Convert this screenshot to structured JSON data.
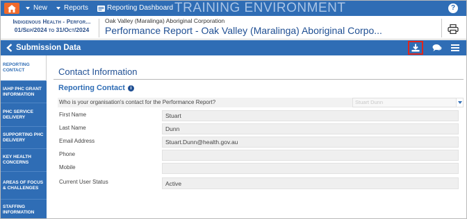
{
  "topnav": {
    "new_label": "New",
    "reports_label": "Reports",
    "dashboard_label": "Reporting Dashboard",
    "environment_banner": "TRAINING ENVIRONMENT"
  },
  "header": {
    "organisation_short": "Indigenous Health - Perfor...",
    "period": "01/Sep/2024 to 31/Oct/2024",
    "organisation_name": "Oak Valley (Maralinga) Aboriginal Corporation",
    "form_title": "Performance Report - Oak Valley (Maralinga) Aboriginal Corpo..."
  },
  "subbar": {
    "title": "Submission Data"
  },
  "sidebar": {
    "items": [
      {
        "label": "Reporting Contact"
      },
      {
        "label": "IAHP PHC Grant Information"
      },
      {
        "label": "PHC Service Delivery"
      },
      {
        "label": "Supporting PHC Delivery"
      },
      {
        "label": "Key Health Concerns"
      },
      {
        "label": "Areas of Focus & Challenges"
      },
      {
        "label": "Staffing Information"
      }
    ]
  },
  "main": {
    "section_title": "Contact Information",
    "subsection_title": "Reporting Contact",
    "question": "Who is your organisation's contact for the Performance Report?",
    "question_value": "Stuart Dunn",
    "fields": [
      {
        "label": "First Name",
        "value": "Stuart"
      },
      {
        "label": "Last Name",
        "value": "Dunn"
      },
      {
        "label": "Email Address",
        "value": "Stuart.Dunn@health.gov.au"
      },
      {
        "label": "Phone",
        "value": ""
      },
      {
        "label": "Mobile",
        "value": ""
      },
      {
        "label": "Current User Status",
        "value": "Active"
      }
    ]
  },
  "colors": {
    "primary": "#2f6db5",
    "home_button": "#f06a2b",
    "highlight_border": "#e0251b"
  }
}
